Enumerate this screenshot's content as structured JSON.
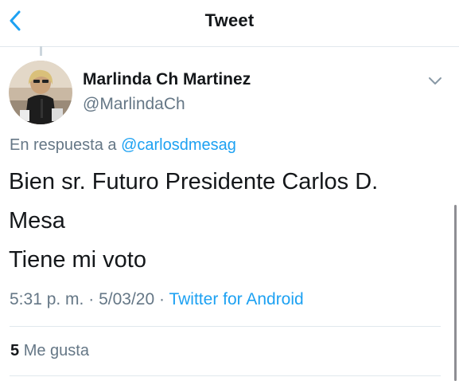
{
  "header": {
    "title": "Tweet",
    "back_icon": "chevron-left-icon",
    "accent_color": "#1da1f2"
  },
  "tweet": {
    "author": {
      "display_name": "Marlinda Ch Martinez",
      "handle": "@MarlindaCh"
    },
    "reply": {
      "prefix": "En respuesta a",
      "mention": "@carlosdmesag"
    },
    "text_lines": [
      "Bien sr. Futuro Presidente Carlos D.",
      "Mesa",
      "Tiene mi voto"
    ],
    "time": "5:31 p. m.",
    "date": "5/03/20",
    "separator": "·",
    "source": "Twitter for Android",
    "likes": {
      "count": "5",
      "label": "Me gusta"
    },
    "menu_icon": "chevron-down-icon"
  },
  "colors": {
    "text": "#14171a",
    "secondary": "#657786",
    "link": "#1da1f2",
    "border": "#e1e8ed"
  }
}
